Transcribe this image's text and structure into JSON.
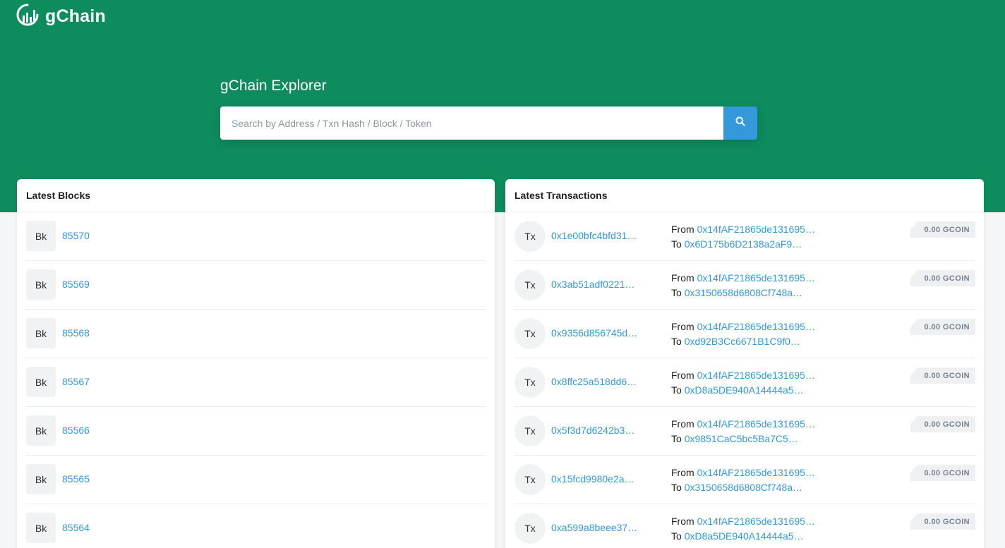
{
  "brand": {
    "name": "gChain",
    "logo_icon": "gchain-logo-icon"
  },
  "hero": {
    "title": "gChain Explorer"
  },
  "search": {
    "placeholder": "Search by Address / Txn Hash / Block / Token",
    "value": "",
    "button_icon": "search-icon"
  },
  "colors": {
    "primary": "#0e8c5e",
    "accent": "#3498db"
  },
  "blocks": {
    "header": "Latest Blocks",
    "badge": "Bk",
    "items": [
      {
        "number": "85570"
      },
      {
        "number": "85569"
      },
      {
        "number": "85568"
      },
      {
        "number": "85567"
      },
      {
        "number": "85566"
      },
      {
        "number": "85565"
      },
      {
        "number": "85564"
      }
    ]
  },
  "transactions": {
    "header": "Latest Transactions",
    "badge": "Tx",
    "from_label": "From",
    "to_label": "To",
    "items": [
      {
        "hash": "0x1e00bfc4bfd31…",
        "from": "0x14fAF21865de131695…",
        "to": "0x6D175b6D2138a2aF9…",
        "amount": "0.00 GCOIN"
      },
      {
        "hash": "0x3ab51adf0221…",
        "from": "0x14fAF21865de131695…",
        "to": "0x3150658d6808Cf748a…",
        "amount": "0.00 GCOIN"
      },
      {
        "hash": "0x9356d856745d…",
        "from": "0x14fAF21865de131695…",
        "to": "0xd92B3Cc6671B1C9f0…",
        "amount": "0.00 GCOIN"
      },
      {
        "hash": "0x8ffc25a518dd6…",
        "from": "0x14fAF21865de131695…",
        "to": "0xD8a5DE940A14444a5…",
        "amount": "0.00 GCOIN"
      },
      {
        "hash": "0x5f3d7d6242b3…",
        "from": "0x14fAF21865de131695…",
        "to": "0x9851CaC5bc5Ba7C5…",
        "amount": "0.00 GCOIN"
      },
      {
        "hash": "0x15fcd9980e2a…",
        "from": "0x14fAF21865de131695…",
        "to": "0x3150658d6808Cf748a…",
        "amount": "0.00 GCOIN"
      },
      {
        "hash": "0xa599a8beee37…",
        "from": "0x14fAF21865de131695…",
        "to": "0xD8a5DE940A14444a5…",
        "amount": "0.00 GCOIN"
      }
    ]
  }
}
